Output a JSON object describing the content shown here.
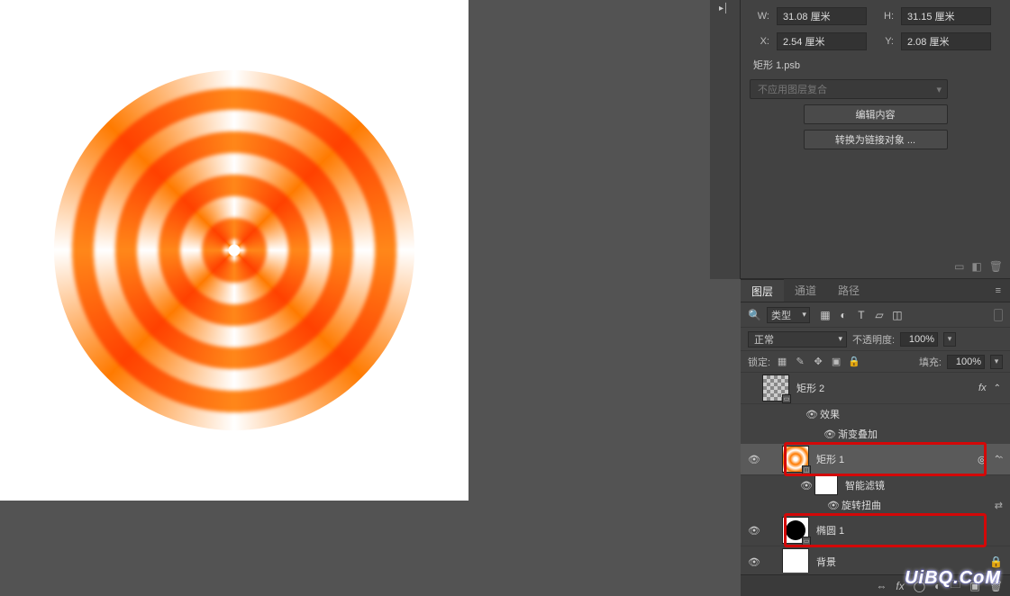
{
  "transform": {
    "w_label": "W:",
    "w_value": "31.08 厘米",
    "h_label": "H:",
    "h_value": "31.15 厘米",
    "x_label": "X:",
    "x_value": "2.54 厘米",
    "y_label": "Y:",
    "y_value": "2.08 厘米"
  },
  "smart_object": {
    "filename": "矩形 1.psb",
    "composite_mode": "不应用图层复合",
    "edit_btn": "编辑内容",
    "convert_btn": "转换为链接对象 ..."
  },
  "panel_tabs": {
    "layers": "图层",
    "channels": "通道",
    "paths": "路径"
  },
  "filter": {
    "kind_label": "类型"
  },
  "blend": {
    "mode": "正常",
    "opacity_label": "不透明度:",
    "opacity_value": "100%"
  },
  "lock": {
    "label": "锁定:",
    "fill_label": "填充:",
    "fill_value": "100%"
  },
  "layers": {
    "rect2": "矩形 2",
    "fx_label": "fx",
    "effects": "效果",
    "grad_overlay": "渐变叠加",
    "rect1": "矩形 1",
    "smart_filters": "智能滤镜",
    "twirl": "旋转扭曲",
    "ellipse1": "椭圆 1",
    "background": "背景"
  },
  "watermark": "UiBQ.CoM"
}
